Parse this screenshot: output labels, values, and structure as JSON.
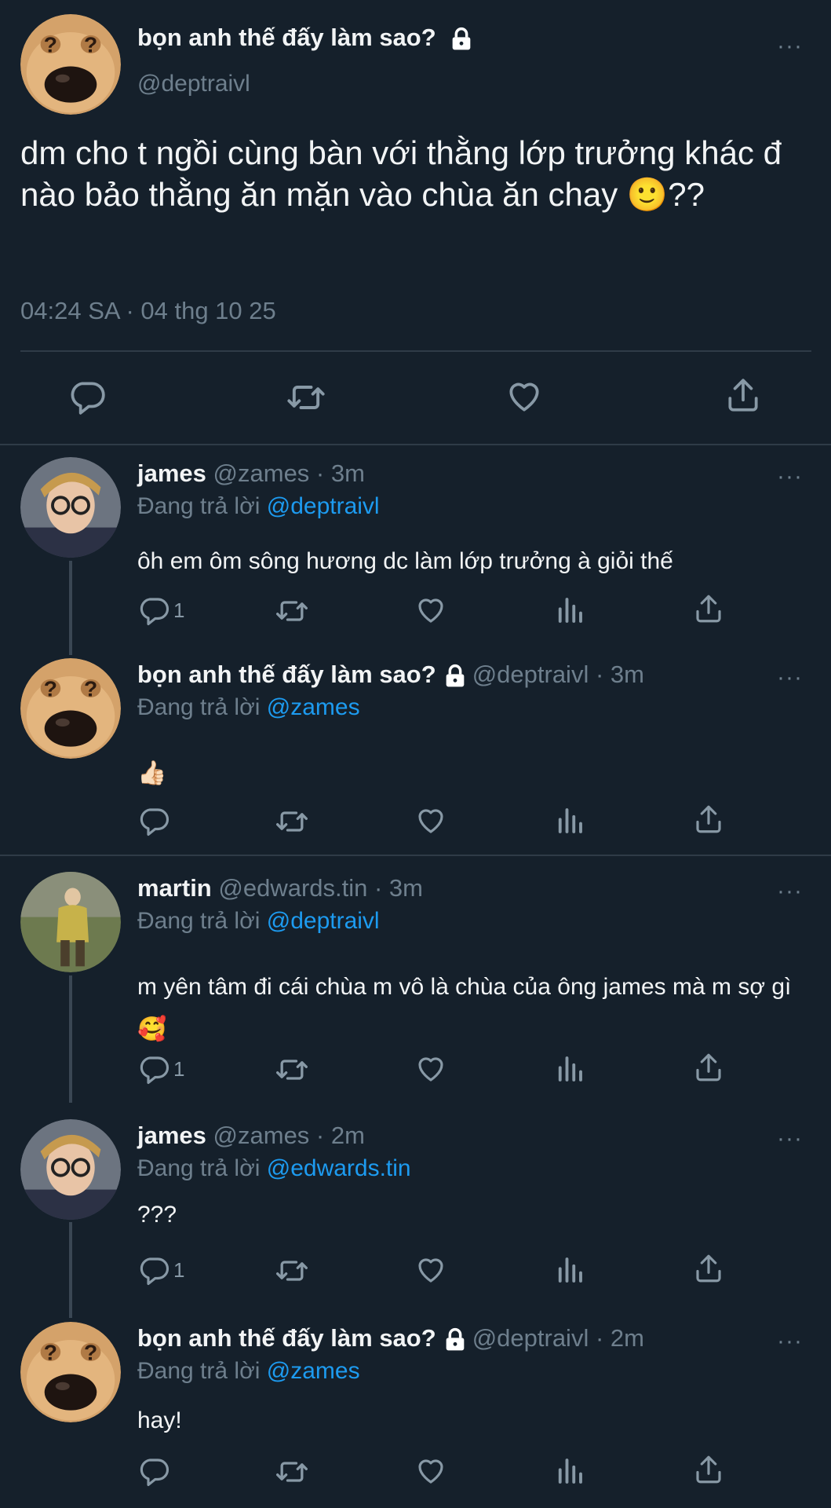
{
  "main_tweet": {
    "name": "bọn anh thế đấy làm sao?",
    "handle": "@deptraivl",
    "text": "dm cho t ngồi cùng bàn với thằng lớp trưởng khác đ nào bảo thằng ăn mặn vào chùa ăn chay 🙂??",
    "timestamp": "04:24 SA · 04 thg 10 25"
  },
  "reply_prefix": "Đang trả lời",
  "more_label": "···",
  "replies": [
    {
      "name": "james",
      "meta": "@zames · 3m",
      "reply_to": "@deptraivl",
      "text": "ôh em ôm sông hương dc làm lớp trưởng à giỏi thế",
      "reply_count": "1"
    },
    {
      "name": "bọn anh thế đấy làm sao?",
      "meta": "@deptraivl · 3m",
      "reply_to": "@zames",
      "text": "👍🏻",
      "reply_count": ""
    },
    {
      "name": "martin",
      "meta": "@edwards.tin · 3m",
      "reply_to": "@deptraivl",
      "text": "m yên tâm đi cái chùa m vô là chùa của ông james mà m sợ gì 🥰",
      "reply_count": "1"
    },
    {
      "name": "james",
      "meta": "@zames · 2m",
      "reply_to": "@edwards.tin",
      "text": "???",
      "reply_count": "1"
    },
    {
      "name": "bọn anh thế đấy làm sao?",
      "meta": "@deptraivl · 2m",
      "reply_to": "@zames",
      "text": "hay!",
      "reply_count": ""
    }
  ],
  "icons": [
    "reply-icon",
    "retweet-icon",
    "like-icon",
    "views-icon",
    "share-icon",
    "lock-icon",
    "more-icon"
  ],
  "colors": {
    "background": "#15202b",
    "link": "#1d9bf0",
    "muted": "#6e7f8d"
  }
}
